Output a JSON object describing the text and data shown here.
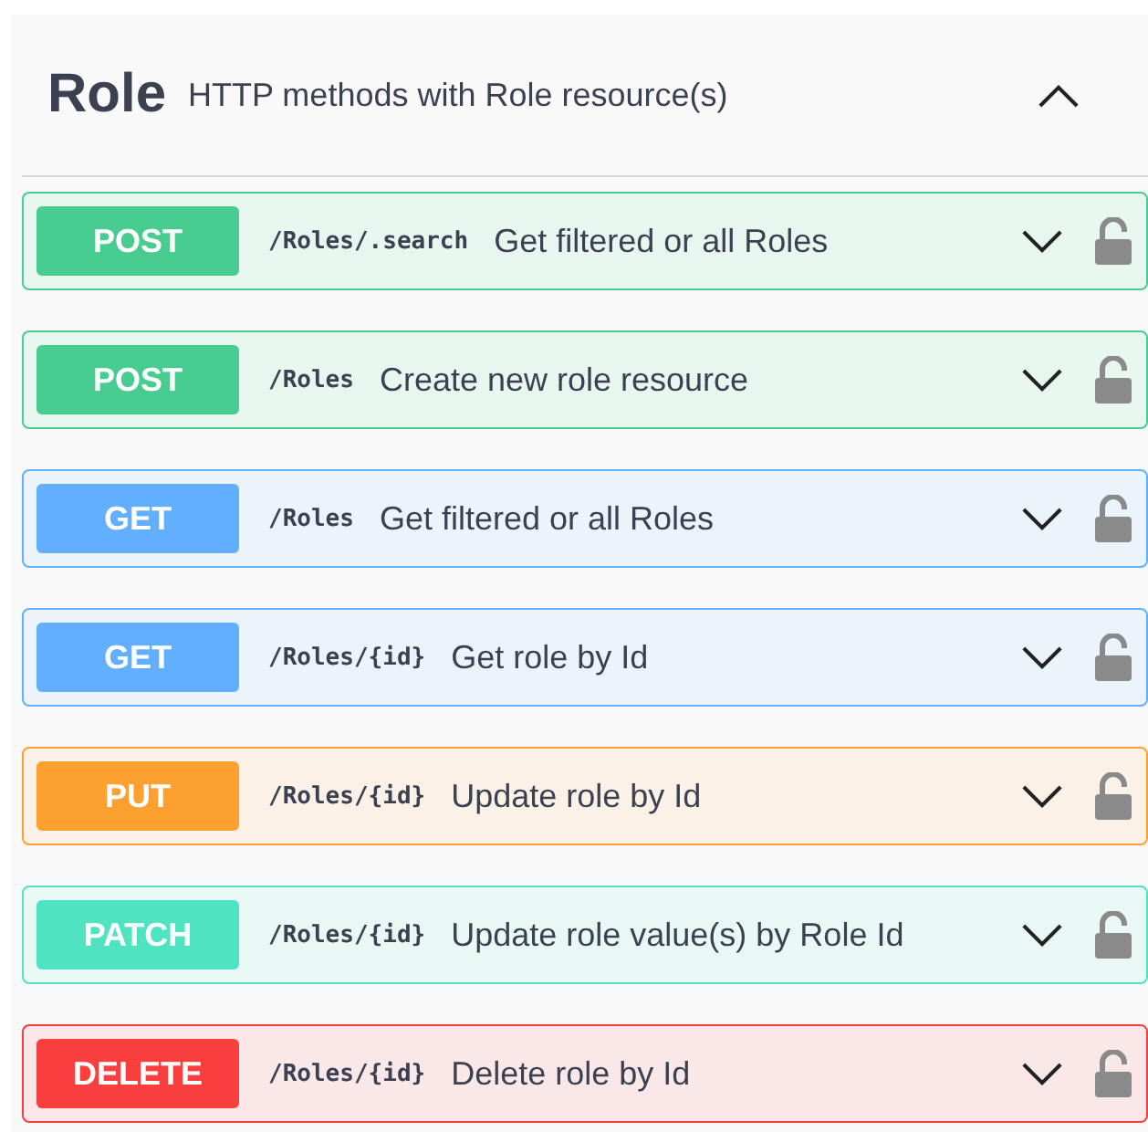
{
  "tag": {
    "name": "Role",
    "description": "HTTP methods with Role resource(s)",
    "expanded": true
  },
  "operations": [
    {
      "method": "POST",
      "kind": "post",
      "path": "/Roles/.search",
      "summary": "Get filtered or all Roles",
      "expanded": false,
      "locked": false
    },
    {
      "method": "POST",
      "kind": "post",
      "path": "/Roles",
      "summary": "Create new role resource",
      "expanded": false,
      "locked": false
    },
    {
      "method": "GET",
      "kind": "get",
      "path": "/Roles",
      "summary": "Get filtered or all Roles",
      "expanded": false,
      "locked": false
    },
    {
      "method": "GET",
      "kind": "get",
      "path": "/Roles/{id}",
      "summary": "Get role by Id",
      "expanded": false,
      "locked": false
    },
    {
      "method": "PUT",
      "kind": "put",
      "path": "/Roles/{id}",
      "summary": "Update role by Id",
      "expanded": false,
      "locked": false
    },
    {
      "method": "PATCH",
      "kind": "patch",
      "path": "/Roles/{id}",
      "summary": "Update role value(s) by Role Id",
      "expanded": false,
      "locked": false
    },
    {
      "method": "DELETE",
      "kind": "delete",
      "path": "/Roles/{id}",
      "summary": "Delete role by Id",
      "expanded": false,
      "locked": false
    }
  ]
}
